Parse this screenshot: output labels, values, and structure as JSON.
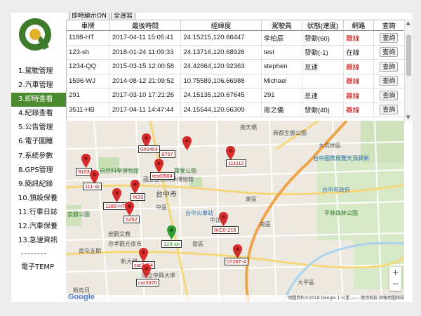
{
  "sidebar": {
    "items": [
      {
        "num": "1.",
        "label": "駕駛管理",
        "active": false
      },
      {
        "num": "2.",
        "label": "汽車管理",
        "active": false
      },
      {
        "num": "3.",
        "label": "即時查看",
        "active": true
      },
      {
        "num": "4.",
        "label": "紀錄查看",
        "active": false
      },
      {
        "num": "5.",
        "label": "公告管理",
        "active": false
      },
      {
        "num": "6.",
        "label": "電子圍籬",
        "active": false
      },
      {
        "num": "7.",
        "label": "系統參數",
        "active": false
      },
      {
        "num": "8.",
        "label": "GPS管理",
        "active": false
      },
      {
        "num": "9.",
        "label": "簡訊紀錄",
        "active": false
      },
      {
        "num": "10.",
        "label": "預設保養",
        "active": false
      },
      {
        "num": "11.",
        "label": "行車日誌",
        "active": false
      },
      {
        "num": "12.",
        "label": "汽車保養",
        "active": false
      },
      {
        "num": "13.",
        "label": "急速資訊",
        "active": false
      }
    ],
    "divider": "--------",
    "temp": "電子TEMP"
  },
  "toolbar": {
    "realtime_btn": "即時顯示ON",
    "all_btn": "全選寫"
  },
  "table": {
    "headers": [
      "車牌",
      "最後時間",
      "經緯度",
      "駕駛員",
      "狀態(速度)",
      "網路",
      "查詢"
    ],
    "rows": [
      {
        "plate": "1188-HT",
        "time": "2017-04-11 15:05:41",
        "coord": "24.15215,120.66447",
        "driver": "李柏辰",
        "status": "發動(60)",
        "net": "離線",
        "q": "查詢"
      },
      {
        "plate": "123-sh",
        "time": "2018-01-24 11:09:33",
        "coord": "24.13716,120.68926",
        "driver": "test",
        "status": "發動(-1)",
        "net": "在線",
        "q": "查詢"
      },
      {
        "plate": "1234-QQ",
        "time": "2015-03-15 12:00:58",
        "coord": "24.42664,120.92363",
        "driver": "stephen",
        "status": "怠速",
        "net": "離線",
        "q": "查詢"
      },
      {
        "plate": "1596-WJ",
        "time": "2014-08-12 21:09:52",
        "coord": "10.75589,106.66988",
        "driver": "Michael",
        "status": "",
        "net": "離線",
        "q": "查詢"
      },
      {
        "plate": "291",
        "time": "2017-03-10 17:21:26",
        "coord": "24.15135,120.67645",
        "driver": "291",
        "status": "怠速",
        "net": "離線",
        "q": "查詢"
      },
      {
        "plate": "3511-HB",
        "time": "2017-04-11 14:47:44",
        "coord": "24.15544,120.66309",
        "driver": "周之僑",
        "status": "發動(40)",
        "net": "離線",
        "q": "查詢"
      }
    ]
  },
  "map": {
    "labels": [
      "南天橋",
      "新都生態公園",
      "大坑地區",
      "台中國際展覽天頂澗新",
      "自然科學博物館",
      "寶覺公園",
      "國立自然科學博物館",
      "台中市",
      "中區",
      "東區",
      "台中市政府",
      "中正路",
      "南區",
      "台中火車站",
      "南區",
      "平林森林公園",
      "國立中興大學",
      "忠孝觀光夜市",
      "大平區",
      "崇勝公園",
      "南屯五期",
      "宏觀文教",
      "新大學",
      "新烏日"
    ],
    "vehicles": [
      {
        "tag": "040404",
        "color": "red"
      },
      {
        "tag": "9757",
        "color": "red"
      },
      {
        "tag": "111112",
        "color": "red"
      },
      {
        "tag": "9103",
        "color": "red"
      },
      {
        "tag": "test0504",
        "color": "red"
      },
      {
        "tag": "111-sk",
        "color": "red"
      },
      {
        "tag": "IK33",
        "color": "red"
      },
      {
        "tag": "1188-HT",
        "color": "red"
      },
      {
        "tag": "5252",
        "color": "red"
      },
      {
        "tag": "123-sh",
        "color": "green"
      },
      {
        "tag": "IKC0-218",
        "color": "red"
      },
      {
        "tag": "0726T-A",
        "color": "red"
      },
      {
        "tag": "car2454",
        "color": "red"
      },
      {
        "tag": "car3370",
        "color": "red"
      }
    ],
    "zoom_in": "+",
    "zoom_out": "−",
    "google": "Google",
    "footer": "地圖資料©2018 Google   1 公里 ⎯⎯⎯⎯   使用條款   回報地圖錯誤"
  }
}
